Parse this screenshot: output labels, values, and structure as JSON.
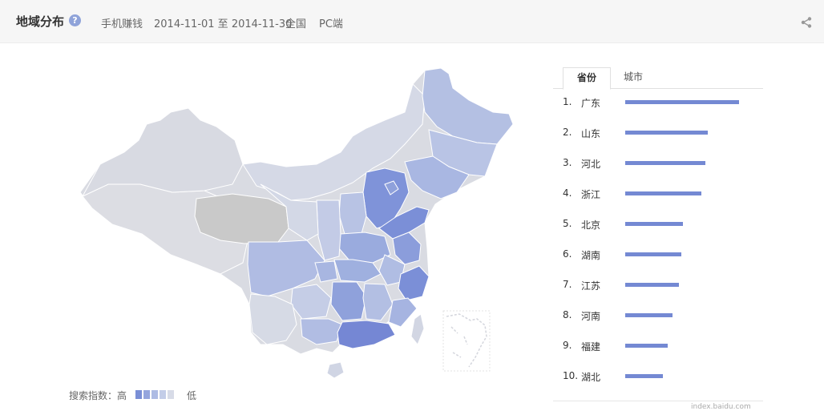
{
  "header": {
    "title": "地域分布",
    "help_icon": "question-icon",
    "keyword": "手机赚钱",
    "date_range": "2014-11-01 至 2014-11-30",
    "region": "全国",
    "platform": "PC端",
    "share_icon": "share-icon"
  },
  "colors": {
    "accent": "#7489d3",
    "map_levels": [
      "#7a8fd6",
      "#94a5dd",
      "#adbbe4",
      "#c3cde8",
      "#d7dbe7"
    ],
    "land_base": "#d9dbe2",
    "land_dark": "#c9c9c9"
  },
  "legend": {
    "label": "搜索指数：",
    "high": "高",
    "low": "低"
  },
  "tabs": [
    "省份",
    "城市"
  ],
  "chart_data": {
    "type": "bar",
    "categories": [
      "广东",
      "山东",
      "河北",
      "浙江",
      "北京",
      "湖南",
      "江苏",
      "河南",
      "福建",
      "湖北"
    ],
    "ranks": [
      "1.",
      "2.",
      "3.",
      "4.",
      "5.",
      "6.",
      "7.",
      "8.",
      "9.",
      "10."
    ],
    "values": [
      142,
      103,
      100,
      95,
      72,
      70,
      67,
      59,
      53,
      47
    ],
    "xlim": [
      0,
      142
    ]
  },
  "credit": "index.baidu.com"
}
